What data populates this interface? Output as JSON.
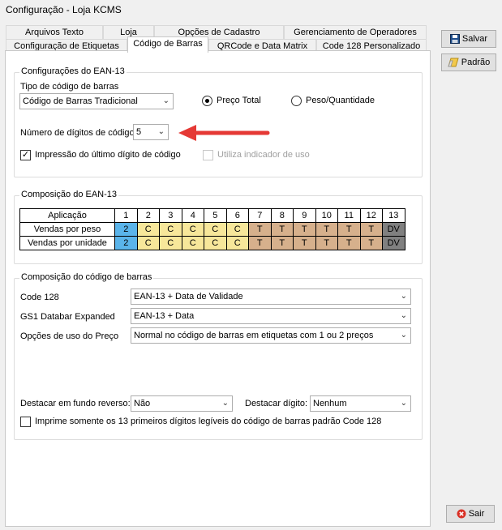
{
  "window": {
    "title": "Configuração - Loja KCMS"
  },
  "tabs_row1": [
    "Arquivos Texto",
    "Loja",
    "Opções de Cadastro",
    "Gerenciamento de Operadores"
  ],
  "tabs_row2": [
    "Configuração de Etiquetas",
    "Código de Barras",
    "QRCode e Data Matrix",
    "Code 128 Personalizado"
  ],
  "ean_config": {
    "title": "Configurações do EAN-13",
    "type_label": "Tipo de código de barras",
    "type_value": "Código de Barras Tradicional",
    "radio_total": "Preço Total",
    "radio_weight": "Peso/Quantidade",
    "digits_label": "Número de dígitos de código",
    "digits_value": "5",
    "print_last_digit": "Impressão do último dígito de código",
    "use_indicator": "Utiliza indicador de uso"
  },
  "composition": {
    "title": "Composição do EAN-13",
    "header": [
      "Aplicação",
      "1",
      "2",
      "3",
      "4",
      "5",
      "6",
      "7",
      "8",
      "9",
      "10",
      "11",
      "12",
      "13"
    ],
    "rows": [
      [
        "Vendas por peso",
        "2",
        "C",
        "C",
        "C",
        "C",
        "C",
        "T",
        "T",
        "T",
        "T",
        "T",
        "T",
        "DV"
      ],
      [
        "Vendas por unidade",
        "2",
        "C",
        "C",
        "C",
        "C",
        "C",
        "T",
        "T",
        "T",
        "T",
        "T",
        "T",
        "DV"
      ]
    ]
  },
  "barcode_comp": {
    "title": "Composição do código de barras",
    "code128_label": "Code 128",
    "code128_value": "EAN-13 + Data de Validade",
    "gs1_label": "GS1 Databar Expanded",
    "gs1_value": "EAN-13 + Data",
    "price_label": "Opções de uso do Preço",
    "price_value": "Normal no código de barras em etiquetas com 1 ou 2 preços",
    "reverse_label": "Destacar em fundo reverso:",
    "reverse_value": "Não",
    "digit_label": "Destacar dígito:",
    "digit_value": "Nenhum",
    "print_first13": "Imprime somente os 13 primeiros dígitos legíveis do código de barras padrão Code 128"
  },
  "buttons": {
    "save": "Salvar",
    "default": "Padrão",
    "exit": "Sair"
  },
  "colors": {
    "blue": "#5ab4ea",
    "yellow": "#f7e79a",
    "tan": "#d6b08c",
    "gray": "#808080",
    "arrow": "#e53935"
  }
}
